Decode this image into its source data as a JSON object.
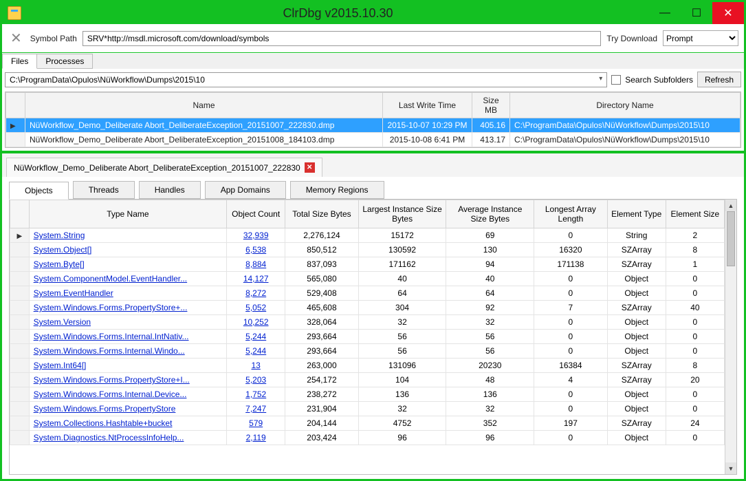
{
  "window": {
    "title": "ClrDbg v2015.10.30"
  },
  "toolbar": {
    "symbolPathLabel": "Symbol Path",
    "symbolPathValue": "SRV*http://msdl.microsoft.com/download/symbols",
    "tryDownloadLabel": "Try Download",
    "promptOption": "Prompt"
  },
  "mainTabs": {
    "files": "Files",
    "processes": "Processes"
  },
  "fileBrowse": {
    "path": "C:\\ProgramData\\Opulos\\NüWorkflow\\Dumps\\2015\\10",
    "searchSubfoldersLabel": "Search Subfolders",
    "refreshLabel": "Refresh"
  },
  "fileGrid": {
    "headers": {
      "name": "Name",
      "lwt": "Last Write Time",
      "size": "Size\nMB",
      "dir": "Directory Name"
    },
    "rows": [
      {
        "name": "NüWorkflow_Demo_Deliberate Abort_DeliberateException_20151007_222830.dmp",
        "lwt": "2015-10-07 10:29 PM",
        "size": "405.16",
        "dir": "C:\\ProgramData\\Opulos\\NüWorkflow\\Dumps\\2015\\10",
        "selected": true
      },
      {
        "name": "NüWorkflow_Demo_Deliberate Abort_DeliberateException_20151008_184103.dmp",
        "lwt": "2015-10-08 6:41 PM",
        "size": "413.17",
        "dir": "C:\\ProgramData\\Opulos\\NüWorkflow\\Dumps\\2015\\10",
        "selected": false
      }
    ]
  },
  "dumpTab": {
    "title": "NüWorkflow_Demo_Deliberate Abort_DeliberateException_20151007_222830"
  },
  "analysisTabs": {
    "objects": "Objects",
    "threads": "Threads",
    "handles": "Handles",
    "appDomains": "App Domains",
    "memoryRegions": "Memory Regions"
  },
  "objectsGrid": {
    "headers": {
      "type": "Type Name",
      "count": "Object Count",
      "total": "Total Size Bytes",
      "largest": "Largest Instance Size Bytes",
      "avg": "Average Instance Size Bytes",
      "arrlen": "Longest Array Length",
      "eltype": "Element Type",
      "elsize": "Element Size"
    },
    "rows": [
      {
        "type": "System.String",
        "count": "32,939",
        "total": "2,276,124",
        "largest": "15172",
        "avg": "69",
        "arrlen": "0",
        "eltype": "String",
        "elsize": "2"
      },
      {
        "type": "System.Object[]",
        "count": "6,538",
        "total": "850,512",
        "largest": "130592",
        "avg": "130",
        "arrlen": "16320",
        "eltype": "SZArray",
        "elsize": "8"
      },
      {
        "type": "System.Byte[]",
        "count": "8,884",
        "total": "837,093",
        "largest": "171162",
        "avg": "94",
        "arrlen": "171138",
        "eltype": "SZArray",
        "elsize": "1"
      },
      {
        "type": "System.ComponentModel.EventHandler...",
        "count": "14,127",
        "total": "565,080",
        "largest": "40",
        "avg": "40",
        "arrlen": "0",
        "eltype": "Object",
        "elsize": "0"
      },
      {
        "type": "System.EventHandler",
        "count": "8,272",
        "total": "529,408",
        "largest": "64",
        "avg": "64",
        "arrlen": "0",
        "eltype": "Object",
        "elsize": "0"
      },
      {
        "type": "System.Windows.Forms.PropertyStore+...",
        "count": "5,052",
        "total": "465,608",
        "largest": "304",
        "avg": "92",
        "arrlen": "7",
        "eltype": "SZArray",
        "elsize": "40"
      },
      {
        "type": "System.Version",
        "count": "10,252",
        "total": "328,064",
        "largest": "32",
        "avg": "32",
        "arrlen": "0",
        "eltype": "Object",
        "elsize": "0"
      },
      {
        "type": "System.Windows.Forms.Internal.IntNativ...",
        "count": "5,244",
        "total": "293,664",
        "largest": "56",
        "avg": "56",
        "arrlen": "0",
        "eltype": "Object",
        "elsize": "0"
      },
      {
        "type": "System.Windows.Forms.Internal.Windo...",
        "count": "5,244",
        "total": "293,664",
        "largest": "56",
        "avg": "56",
        "arrlen": "0",
        "eltype": "Object",
        "elsize": "0"
      },
      {
        "type": "System.Int64[]",
        "count": "13",
        "total": "263,000",
        "largest": "131096",
        "avg": "20230",
        "arrlen": "16384",
        "eltype": "SZArray",
        "elsize": "8"
      },
      {
        "type": "System.Windows.Forms.PropertyStore+I...",
        "count": "5,203",
        "total": "254,172",
        "largest": "104",
        "avg": "48",
        "arrlen": "4",
        "eltype": "SZArray",
        "elsize": "20"
      },
      {
        "type": "System.Windows.Forms.Internal.Device...",
        "count": "1,752",
        "total": "238,272",
        "largest": "136",
        "avg": "136",
        "arrlen": "0",
        "eltype": "Object",
        "elsize": "0"
      },
      {
        "type": "System.Windows.Forms.PropertyStore",
        "count": "7,247",
        "total": "231,904",
        "largest": "32",
        "avg": "32",
        "arrlen": "0",
        "eltype": "Object",
        "elsize": "0"
      },
      {
        "type": "System.Collections.Hashtable+bucket",
        "count": "579",
        "total": "204,144",
        "largest": "4752",
        "avg": "352",
        "arrlen": "197",
        "eltype": "SZArray",
        "elsize": "24"
      },
      {
        "type": "System.Diagnostics.NtProcessInfoHelp...",
        "count": "2,119",
        "total": "203,424",
        "largest": "96",
        "avg": "96",
        "arrlen": "0",
        "eltype": "Object",
        "elsize": "0"
      }
    ]
  }
}
